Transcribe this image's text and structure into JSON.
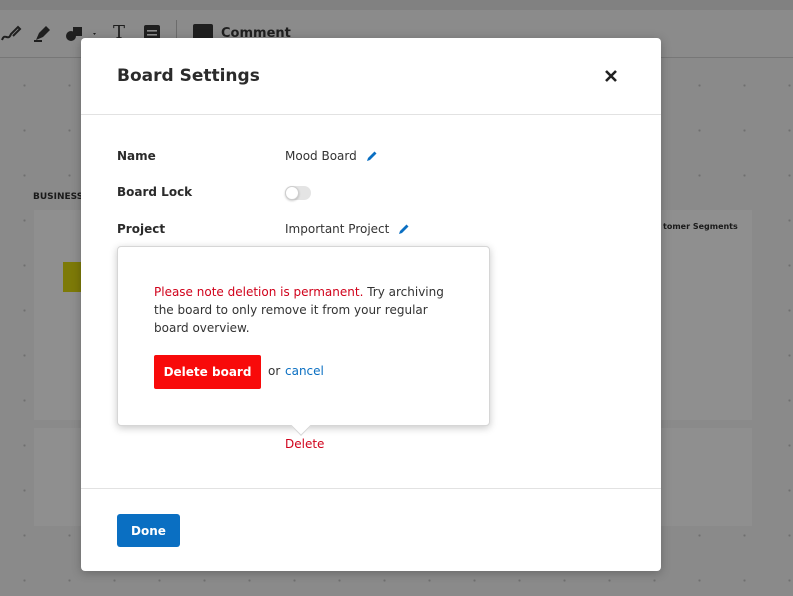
{
  "toolbar": {
    "comment_label": "Comment",
    "icons": [
      "pen-icon",
      "highlighter-icon",
      "shapes-icon",
      "text-icon",
      "sticky-note-icon",
      "comment-icon"
    ]
  },
  "background": {
    "board_heading": "BUSINESS",
    "segment_heading": "tomer Segments"
  },
  "modal": {
    "title": "Board Settings",
    "close_label": "✕",
    "fields": {
      "name_label": "Name",
      "name_value": "Mood Board",
      "lock_label": "Board Lock",
      "lock_enabled": false,
      "project_label": "Project",
      "project_value": "Important Project"
    },
    "delete_link": "Delete",
    "done_label": "Done"
  },
  "delete_popover": {
    "warning": "Please note deletion is permanent.",
    "message": " Try archiving the board to only remove it from your regular board overview.",
    "delete_button": "Delete board",
    "or_text": "or",
    "cancel_label": "cancel"
  },
  "colors": {
    "accent": "#0a6fc2",
    "danger": "#d0021b",
    "danger_button": "#f80a0a",
    "overlay": "#7f7f7f"
  }
}
